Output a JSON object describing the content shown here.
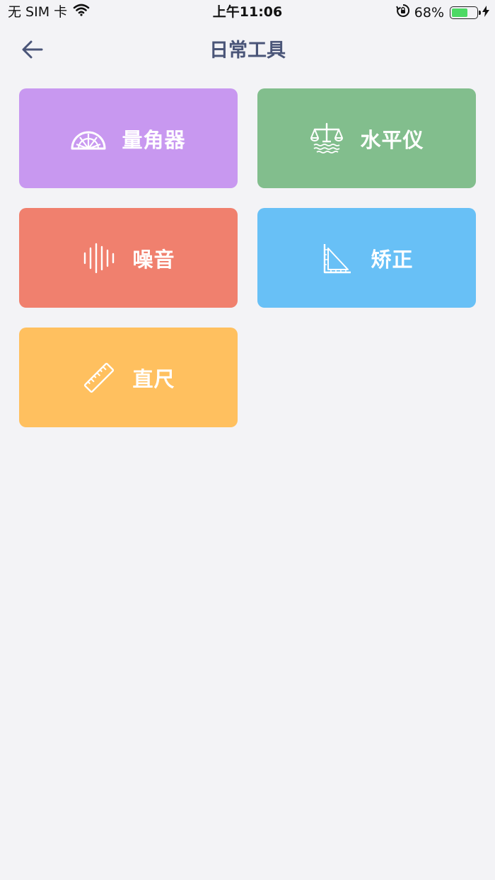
{
  "status_bar": {
    "carrier": "无 SIM 卡",
    "time": "上午11:06",
    "battery_text": "68%",
    "battery_level": 0.68,
    "wifi_icon": "wifi-icon",
    "rotation_lock_icon": "rotation-lock-icon",
    "charging_icon": "charging-bolt-icon"
  },
  "nav": {
    "title": "日常工具",
    "back_icon": "back-arrow-icon"
  },
  "tools": [
    {
      "label": "量角器",
      "icon": "protractor-icon",
      "color": "#c898f0"
    },
    {
      "label": "水平仪",
      "icon": "balance-scale-icon",
      "color": "#82be8d"
    },
    {
      "label": "噪音",
      "icon": "sound-wave-icon",
      "color": "#f0806e"
    },
    {
      "label": "矫正",
      "icon": "set-square-icon",
      "color": "#68c0f6"
    },
    {
      "label": "直尺",
      "icon": "ruler-icon",
      "color": "#ffc05f"
    }
  ],
  "colors": {
    "background": "#f3f3f6",
    "title": "#4a5578",
    "battery_fill": "#4cd964"
  }
}
